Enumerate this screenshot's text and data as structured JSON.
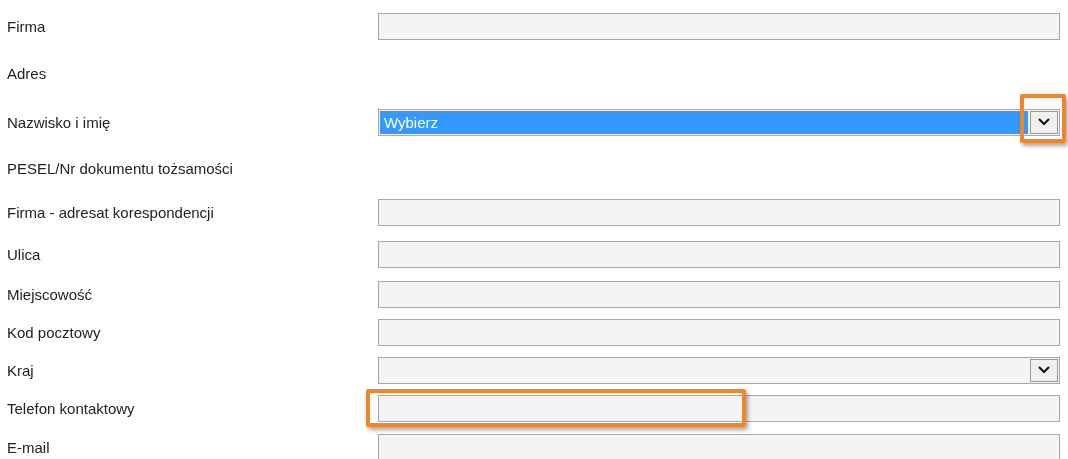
{
  "form": {
    "rows": [
      {
        "label": "Firma",
        "kind": "text",
        "highlighted": false
      },
      {
        "label": "Adres",
        "kind": "none",
        "highlighted": false
      },
      {
        "label": "Nazwisko i imię",
        "kind": "select",
        "value": "Wybierz",
        "selected": true,
        "highlighted": true
      },
      {
        "label": "PESEL/Nr dokumentu tożsamości",
        "kind": "none",
        "highlighted": false
      },
      {
        "label": "Firma - adresat korespondencji",
        "kind": "text",
        "highlighted": false
      },
      {
        "label": "Ulica",
        "kind": "text",
        "highlighted": false
      },
      {
        "label": "Miejscowość",
        "kind": "text",
        "highlighted": false
      },
      {
        "label": "Kod pocztowy",
        "kind": "text",
        "highlighted": false
      },
      {
        "label": "Kraj",
        "kind": "select",
        "selected": false,
        "highlighted": false
      },
      {
        "label": "Telefon kontaktowy",
        "kind": "text",
        "highlighted": true
      },
      {
        "label": "E-mail",
        "kind": "text",
        "highlighted": false
      }
    ]
  }
}
